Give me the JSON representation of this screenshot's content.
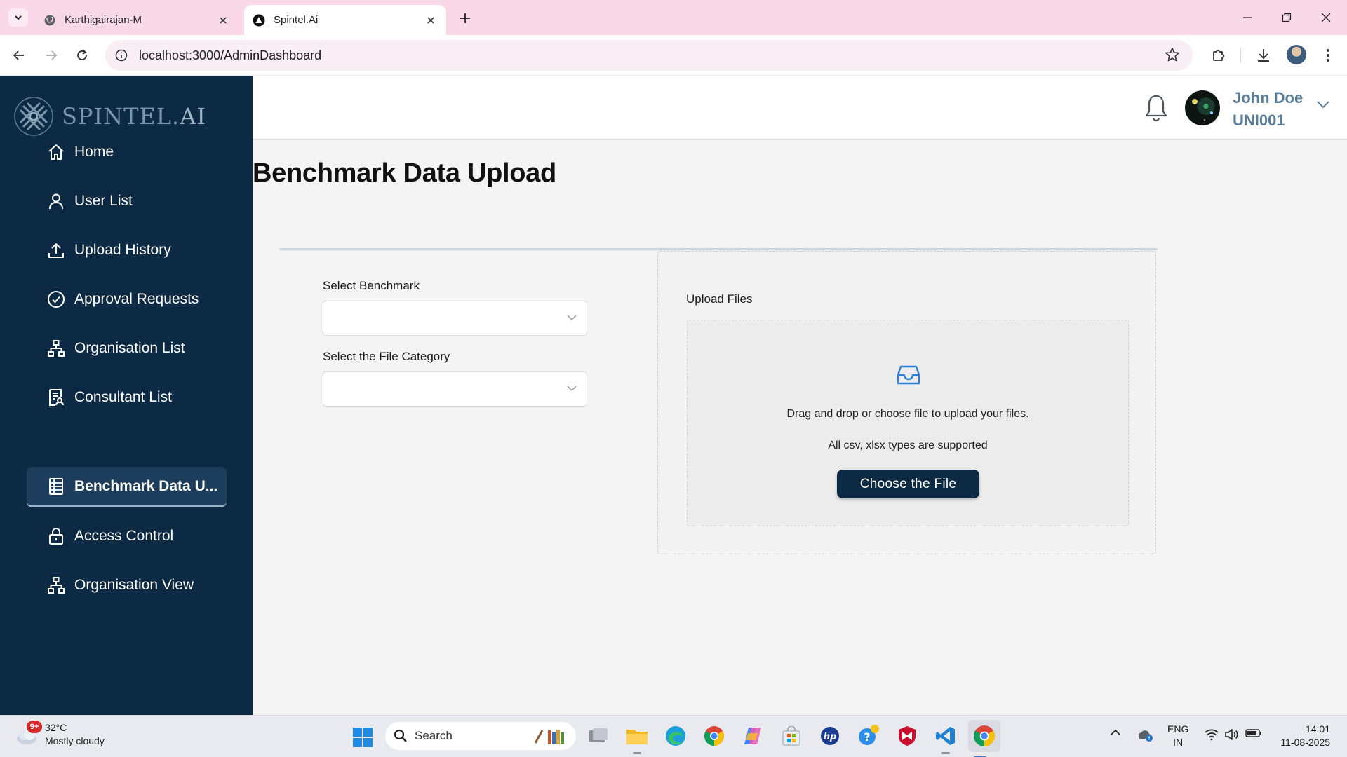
{
  "browser": {
    "tabs": [
      {
        "title": "Karthigairajan-M",
        "active": false
      },
      {
        "title": "Spintel.Ai",
        "active": true
      }
    ],
    "url": "localhost:3000/AdminDashboard"
  },
  "app": {
    "logo": {
      "brand": "SPINTEL.",
      "suffix": "AI"
    },
    "sidebar": {
      "items": [
        {
          "label": "Home",
          "icon": "home-icon",
          "active": false
        },
        {
          "label": "User List",
          "icon": "user-icon",
          "active": false
        },
        {
          "label": "Upload History",
          "icon": "upload-icon",
          "active": false
        },
        {
          "label": "Approval Requests",
          "icon": "check-circle-icon",
          "active": false
        },
        {
          "label": "Organisation List",
          "icon": "org-chart-icon",
          "active": false
        },
        {
          "label": "Consultant List",
          "icon": "consultant-list-icon",
          "active": false
        },
        {
          "label": "Benchmark Data U...",
          "icon": "spreadsheet-icon",
          "active": true
        },
        {
          "label": "Access Control",
          "icon": "lock-icon",
          "active": false
        },
        {
          "label": "Organisation View",
          "icon": "org-chart-icon",
          "active": false
        }
      ]
    },
    "header": {
      "user_name": "John Doe",
      "user_id": "UNI001"
    },
    "main": {
      "title": "Benchmark Data Upload",
      "select_benchmark_label": "Select Benchmark",
      "select_benchmark_value": "",
      "select_category_label": "Select the File Category",
      "select_category_value": "",
      "upload": {
        "label": "Upload Files",
        "drag_text": "Drag and drop or choose file to upload your files.",
        "types_text": "All csv, xlsx types are supported",
        "button_label": "Choose the File"
      }
    },
    "colors": {
      "sidebar_bg": "#0d2a44",
      "accent": "#0d2a44",
      "user_name_color": "#5a7d9a"
    }
  },
  "taskbar": {
    "weather": {
      "temp": "32°C",
      "condition": "Mostly cloudy",
      "badge": "9+"
    },
    "search_placeholder": "Search",
    "language": {
      "line1": "ENG",
      "line2": "IN"
    },
    "time": "14:01",
    "date": "11-08-2025"
  }
}
